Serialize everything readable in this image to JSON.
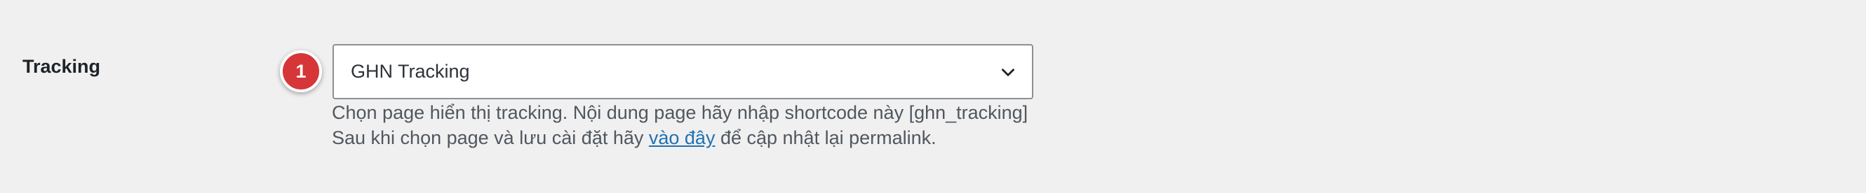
{
  "field": {
    "label": "Tracking",
    "badge_number": "1",
    "select": {
      "selected_value": "GHN Tracking",
      "icon": "chevron-down-icon"
    },
    "description": {
      "line1": "Chọn page hiển thị tracking. Nội dung page hãy nhập shortcode này [ghn_tracking]",
      "line2_before": "Sau khi chọn page và lưu cài đặt hãy ",
      "line2_link": "vào đây",
      "line2_after": " để cập nhật lại permalink."
    }
  },
  "colors": {
    "background": "#f0f0f1",
    "badge": "#d63638",
    "link": "#2271b1",
    "border": "#8c8f94"
  }
}
